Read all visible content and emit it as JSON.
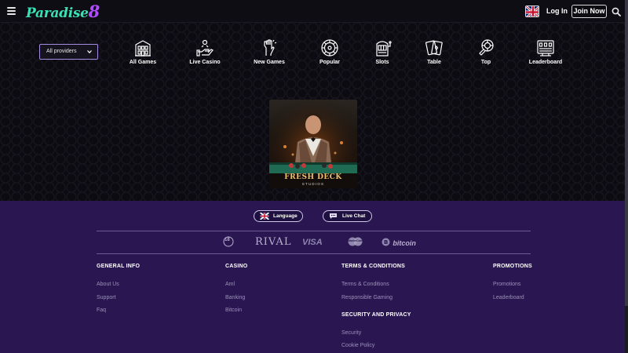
{
  "header": {
    "logo_text": "Paradise",
    "logo_digit": "8",
    "login_label": "Log In",
    "join_label": "Join Now"
  },
  "filters": {
    "provider_select": "All providers"
  },
  "categories": [
    {
      "label": "All Games",
      "icon": "casino-building-icon"
    },
    {
      "label": "Live Casino",
      "icon": "dealer-hand-icon"
    },
    {
      "label": "New Games",
      "icon": "hand-sparkle-icon"
    },
    {
      "label": "Popular",
      "icon": "roulette-icon"
    },
    {
      "label": "Slots",
      "icon": "slot-machine-icon"
    },
    {
      "label": "Table",
      "icon": "cards-icon"
    },
    {
      "label": "Top",
      "icon": "chip-icon"
    },
    {
      "label": "Leaderboard",
      "icon": "leaderboard-icon"
    }
  ],
  "game": {
    "title": "FRESH DECK",
    "subtitle": "STUDIOS"
  },
  "footer": {
    "language_label": "Language",
    "livechat_label": "Live Chat",
    "payments": {
      "age": "18",
      "rival": "RIVAL",
      "visa": "VISA",
      "mastercard": "MasterCard",
      "bitcoin": "bitcoin"
    },
    "columns": [
      {
        "heading": "GENERAL INFO",
        "links": [
          "About Us",
          "Support",
          "Faq"
        ]
      },
      {
        "heading": "CASINO",
        "links": [
          "Aml",
          "Banking",
          "Bitcoin"
        ]
      },
      {
        "heading": "TERMS & CONDITIONS",
        "links": [
          "Terms & Conditions",
          "Responsible Gaming"
        ]
      },
      {
        "heading": "SECURITY AND PRIVACY",
        "links": [
          "Security",
          "Cookie Policy"
        ]
      },
      {
        "heading": "PROMOTIONS",
        "links": [
          "Promotions",
          "Leaderboard"
        ]
      }
    ]
  },
  "colors": {
    "footer_bg": "#2a1650",
    "logo_green": "#3be0b4",
    "logo_purple": "#b04cff",
    "accent_border": "#a48ce0"
  }
}
